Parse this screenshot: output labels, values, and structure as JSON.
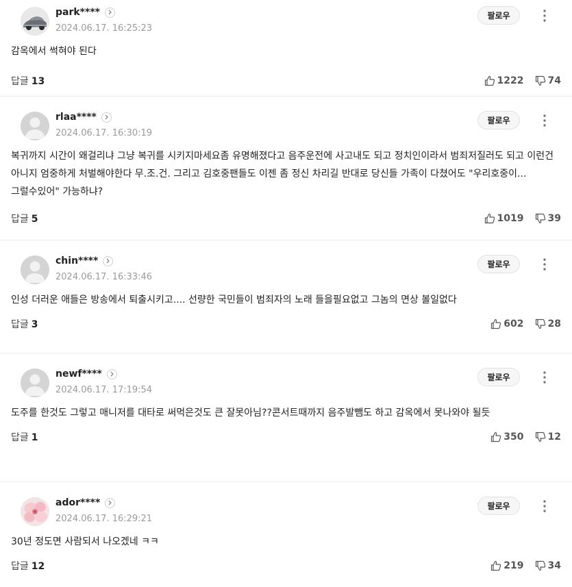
{
  "ui": {
    "follow_label": "팔로우",
    "reply_label": "답글"
  },
  "comments": [
    {
      "nick": "park****",
      "date": "2024.06.17. 16:25:23",
      "text": "감옥에서 썩혀야 된다",
      "replies": "13",
      "likes": "1222",
      "dislikes": "74",
      "avatar": "car-photo"
    },
    {
      "nick": "rlaa****",
      "date": "2024.06.17. 16:30:19",
      "text": "복귀까지 시간이 왜걸리냐 그냥 복귀를 시키지마세요좀 유명해졌다고 음주운전에 사고내도 되고 정치인이라서 범죄저질러도 되고 이런건 아니지 엄중하게 처벌해야한다 무.조.건. 그리고 김호중팬들도 이젠 좀 정신 차리길 반대로 당신들 가족이 다쳤어도 \"우리호중이... 그럴수있어\" 가능하냐?",
      "replies": "5",
      "likes": "1019",
      "dislikes": "39",
      "avatar": "default"
    },
    {
      "nick": "chin****",
      "date": "2024.06.17. 16:33:46",
      "text": "인성 더러운 애들은 방송에서 퇴출시키고.... 선량한 국민들이 범죄자의 노래 들을필요없고 그놈의 면상 볼일없다",
      "replies": "3",
      "likes": "602",
      "dislikes": "28",
      "avatar": "default"
    },
    {
      "nick": "newf****",
      "date": "2024.06.17. 17:19:54",
      "text": "도주를 한것도 그렇고 매니저를 대타로 써먹은것도 큰 잘못아님??콘서트때까지 음주발뺌도 하고 감옥에서 못나와야 될듯",
      "replies": "1",
      "likes": "350",
      "dislikes": "12",
      "avatar": "default"
    },
    {
      "nick": "ador****",
      "date": "2024.06.17. 16:29:21",
      "text": "30년 정도면 사람되서 나오겠네 ㅋㅋ",
      "replies": "12",
      "likes": "219",
      "dislikes": "34",
      "avatar": "flower-photo"
    }
  ],
  "colors": {
    "text": "#222222",
    "meta": "#9a9a9a",
    "divider": "#ececec",
    "follow_bg": "#f6f6f6"
  }
}
